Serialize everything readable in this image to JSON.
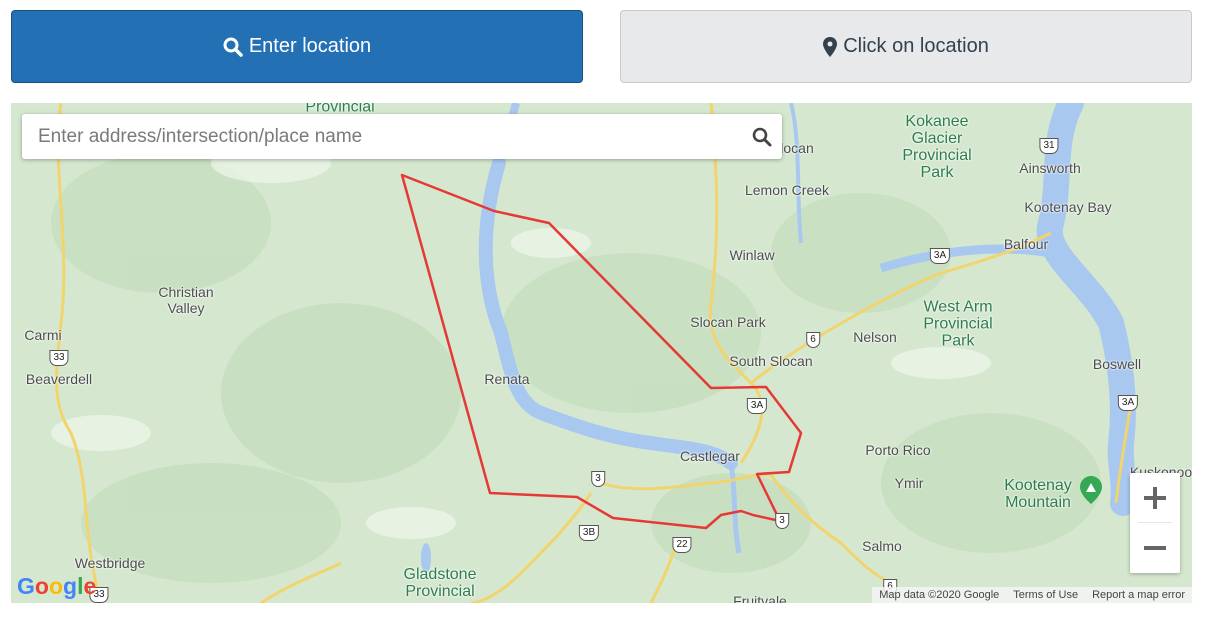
{
  "buttons": {
    "enter_location": "Enter location",
    "click_location": "Click on location"
  },
  "search": {
    "placeholder": "Enter address/intersection/place name"
  },
  "map": {
    "places": [
      {
        "name": "Slocan",
        "display": "locan"
      },
      {
        "name": "Lemon Creek",
        "display": "Lemon Creek"
      },
      {
        "name": "Winlaw",
        "display": "Winlaw"
      },
      {
        "name": "Slocan Park",
        "display": "Slocan Park"
      },
      {
        "name": "South Slocan",
        "display": "South Slocan"
      },
      {
        "name": "Nelson",
        "display": "Nelson"
      },
      {
        "name": "Ainsworth",
        "display": "Ainsworth"
      },
      {
        "name": "Kootenay Bay",
        "display": "Kootenay Bay"
      },
      {
        "name": "Balfour",
        "display": "Balfour"
      },
      {
        "name": "Boswell",
        "display": "Boswell"
      },
      {
        "name": "Christian Valley",
        "display": "Christian\nValley"
      },
      {
        "name": "Carmi",
        "display": "Carmi"
      },
      {
        "name": "Beaverdell",
        "display": "Beaverdell"
      },
      {
        "name": "Renata",
        "display": "Renata"
      },
      {
        "name": "Castlegar",
        "display": "Castlegar"
      },
      {
        "name": "Porto Rico",
        "display": "Porto Rico"
      },
      {
        "name": "Ymir",
        "display": "Ymir"
      },
      {
        "name": "Salmo",
        "display": "Salmo"
      },
      {
        "name": "Westbridge",
        "display": "Westbridge"
      },
      {
        "name": "Fruitvale",
        "display": "Fruitvale"
      },
      {
        "name": "Kuskonook",
        "display": "Kuskonoo"
      }
    ],
    "parks": [
      {
        "name": "Provincial",
        "display": "Provincial"
      },
      {
        "name": "Kokanee Glacier Provincial Park",
        "display": "Kokanee\nGlacier\nProvincial\nPark"
      },
      {
        "name": "West Arm Provincial Park",
        "display": "West Arm\nProvincial\nPark"
      },
      {
        "name": "Kootenay Mountain",
        "display": "Kootenay\nMountain"
      },
      {
        "name": "Gladstone Provincial",
        "display": "Gladstone\nProvincial"
      }
    ],
    "shields": [
      "31",
      "3A",
      "6",
      "3A",
      "3A",
      "33",
      "3",
      "3B",
      "22",
      "3",
      "33",
      "6"
    ],
    "attribution": {
      "map_data": "Map data ©2020 Google",
      "terms": "Terms of Use",
      "report": "Report a map error"
    },
    "logo_text": "Google",
    "colors": {
      "polygon": "#e53935",
      "water": "#a8c8f0",
      "land": "#d5e8cf",
      "primary_button": "#2370b5"
    },
    "icons": [
      "search-icon",
      "map-pin-icon",
      "zoom-in-icon",
      "zoom-out-icon",
      "park-marker-icon"
    ]
  }
}
